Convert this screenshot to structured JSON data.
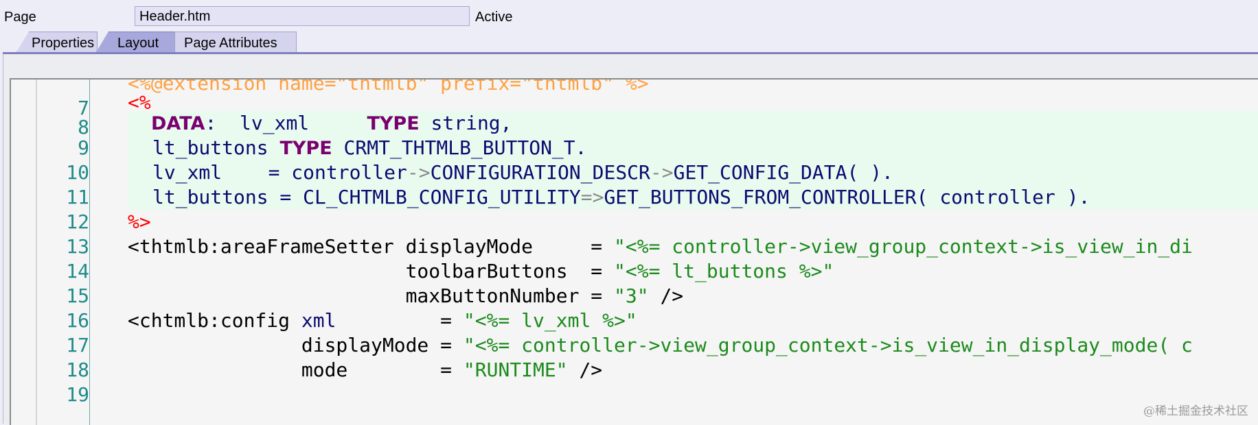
{
  "header": {
    "page_label": "Page",
    "page_value": "Header.htm",
    "status": "Active"
  },
  "tabs": [
    {
      "label": "Properties",
      "active": false
    },
    {
      "label": "Layout",
      "active": true
    },
    {
      "label": "Page Attributes",
      "active": false
    }
  ],
  "editor": {
    "line_numbers": [
      "7",
      "8",
      "9",
      "10",
      "11",
      "12",
      "13",
      "14",
      "15",
      "16",
      "17",
      "18",
      "19"
    ],
    "lines": {
      "l7": "<%@extension name=\"thtmlb\" prefix=\"thtmlb\" %>",
      "l8": "<%",
      "l9_kw1": "DATA",
      "l9_a": ":  lv_xml     ",
      "l9_kw2": "TYPE",
      "l9_b": " string,",
      "l10_a": "lt_buttons ",
      "l10_kw": "TYPE",
      "l10_b": " CRMT_THTMLB_BUTTON_T.",
      "l11_a": "lv_xml    = controller",
      "l11_op": "->",
      "l11_b": "CONFIGURATION_DESCR",
      "l11_op2": "->",
      "l11_c": "GET_CONFIG_DATA",
      "l11_d": "( ).",
      "l12_a": "lt_buttons = CL_CHTMLB_CONFIG_UTILITY",
      "l12_op": "=>",
      "l12_b": "GET_BUTTONS_FROM_CONTROLLER",
      "l12_c": "( controller ).",
      "l13": "%>",
      "l14_a": "<thtmlb:areaFrameSetter displayMode     = ",
      "l14_s": "\"<%= controller->view_group_context->is_view_in_di",
      "l15_a": "                        toolbarButtons  = ",
      "l15_s": "\"<%= lt_buttons %>\"",
      "l16_a": "                        maxButtonNumber = ",
      "l16_s": "\"3\"",
      "l16_b": " />",
      "l17_a": "<chtmlb:config ",
      "l17_attr": "xml",
      "l17_b": "         = ",
      "l17_s": "\"<%= lv_xml %>\"",
      "l18_a": "               displayMode = ",
      "l18_s": "\"<%= controller->view_group_context->is_view_in_display_mode( c",
      "l19_a": "               mode        = ",
      "l19_s": "\"RUNTIME\"",
      "l19_b": " />"
    }
  },
  "watermark": "@稀土掘金技术社区",
  "colors": {
    "directive": "#ffa040",
    "tag_delim": "#ff0000",
    "keyword": "#7a0070",
    "identifier": "#0a0a70",
    "string": "#1b8a1b",
    "abap_block_bg": "#e9fbef",
    "line_number": "#1f8a8a"
  }
}
